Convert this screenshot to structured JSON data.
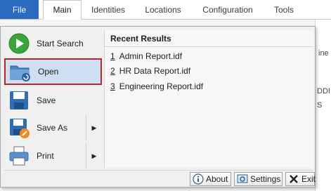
{
  "tabs": {
    "file": "File",
    "items": [
      "Main",
      "Identities",
      "Locations",
      "Configuration",
      "Tools"
    ],
    "active": "Main"
  },
  "background_fragments": [
    "ine",
    "DDI",
    "S"
  ],
  "menu": {
    "commands": [
      {
        "label": "Start Search",
        "icon": "play-icon"
      },
      {
        "label": "Open",
        "icon": "open-folder-icon",
        "selected": true
      },
      {
        "label": "Save",
        "icon": "save-icon"
      },
      {
        "label": "Save As",
        "icon": "save-as-icon",
        "has_submenu": true
      },
      {
        "label": "Print",
        "icon": "print-icon",
        "has_submenu": true
      }
    ],
    "submenu_arrow": "▶",
    "recent_title": "Recent Results",
    "recent": [
      {
        "num": "1",
        "name": "Admin Report.idf"
      },
      {
        "num": "2",
        "name": "HR Data Report.idf"
      },
      {
        "num": "3",
        "name": "Engineering Report.idf"
      }
    ],
    "buttons": {
      "about": "About",
      "settings": "Settings",
      "exit": "Exit"
    }
  },
  "colors": {
    "file_tab": "#2b6bbf",
    "selected_bg": "#cfdff3",
    "selected_border": "#b02a2a",
    "play_green": "#3aa53a"
  }
}
